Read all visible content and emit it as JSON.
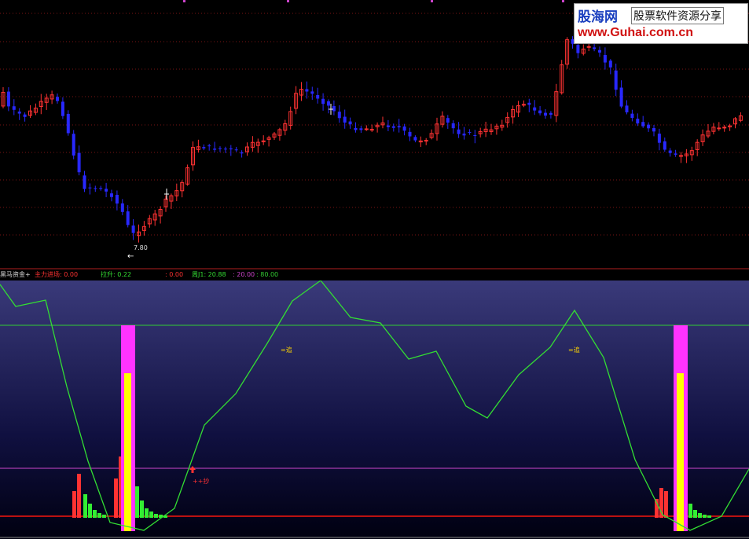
{
  "price_chart": {
    "low_price_label": "7.80",
    "low_arrow": "←"
  },
  "indicator_bar": {
    "name": "黑马资金+",
    "main_force": "主力进场: 0.00",
    "pull_up": "拉升: 0.22",
    "val3": ": 0.00",
    "weekly_j1": "周J1: 20.88",
    "level_low": ": 20.00",
    "level_high": ": 80.00"
  },
  "indicator_chart": {
    "chase_label_1": "=追",
    "chase_label_2": "=追",
    "buy_label": "++抄"
  },
  "logo": {
    "brand": "股海网",
    "tagline": "股票软件资源分享",
    "url": "www.Guhai.com.cn"
  },
  "colors": {
    "up": "#ff3232",
    "down": "#2828ff",
    "line": "#33dd33",
    "level80": "#33cc33",
    "level20": "#cc44cc",
    "magenta": "#ff33ff",
    "yellow": "#ffff00"
  }
}
